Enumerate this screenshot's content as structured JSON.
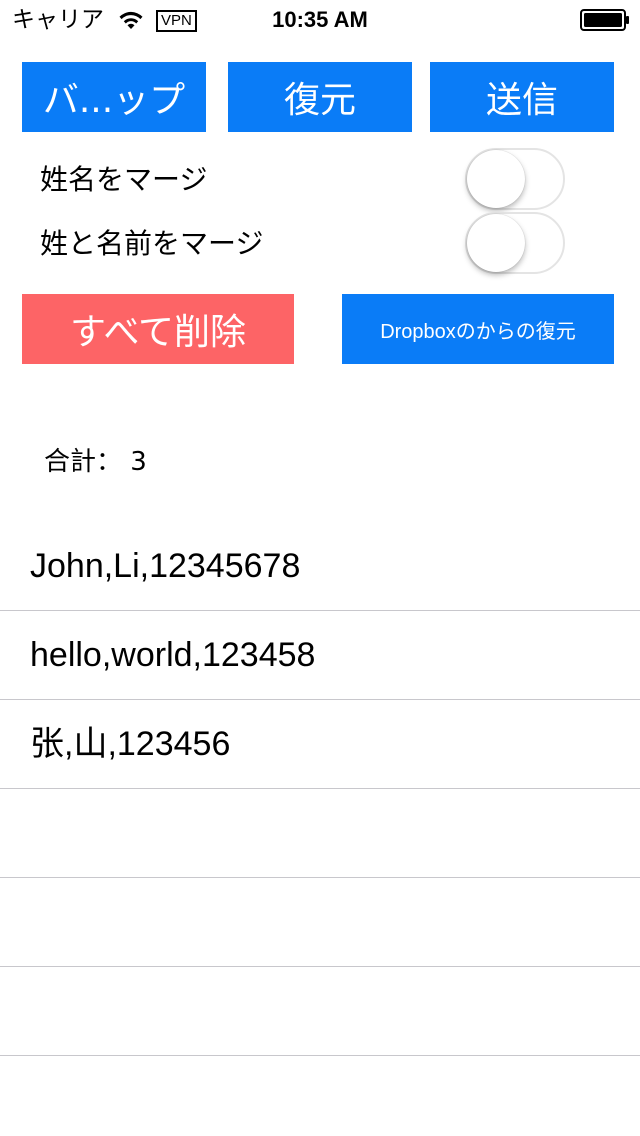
{
  "status_bar": {
    "carrier": "キャリア",
    "vpn": "VPN",
    "time": "10:35 AM"
  },
  "buttons": {
    "backup": "バ...ップ",
    "restore": "復元",
    "send": "送信",
    "delete_all": "すべて削除",
    "dropbox_restore": "Dropboxのからの復元"
  },
  "toggles": [
    {
      "label": "姓名をマージ",
      "on": false
    },
    {
      "label": "姓と名前をマージ",
      "on": false
    }
  ],
  "total": "合計： 3",
  "records": [
    "John,Li,12345678",
    "hello,world,123458",
    "张,山,123456",
    "",
    "",
    ""
  ],
  "colors": {
    "primary_button": "#0a7cf7",
    "delete_button": "#fd6466",
    "separator": "#c8c7cc"
  }
}
